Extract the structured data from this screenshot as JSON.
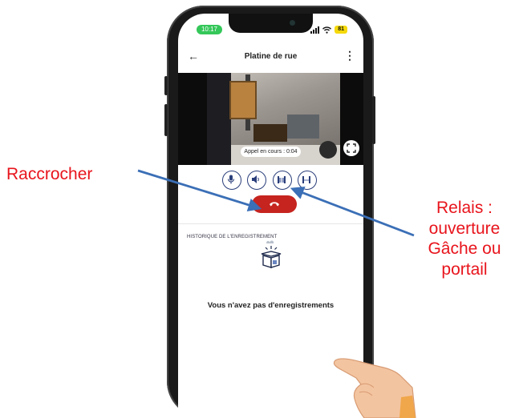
{
  "annotations": {
    "left": "Raccrocher",
    "right_lines": [
      "Relais :",
      "ouverture",
      "Gâche ou",
      "portail"
    ]
  },
  "status_bar": {
    "time": "10:17",
    "battery": "81"
  },
  "app_bar": {
    "title": "Platine de rue",
    "back_icon": "arrow-left-icon",
    "menu_icon": "kebab-menu-icon"
  },
  "video": {
    "call_status": "Appel en cours : 0:04"
  },
  "controls": [
    {
      "name": "microphone",
      "icon": "microphone-icon"
    },
    {
      "name": "speaker",
      "icon": "speaker-icon"
    },
    {
      "name": "relay-1",
      "icon": "gate-icon"
    },
    {
      "name": "relay-2",
      "icon": "gate-icon"
    }
  ],
  "history": {
    "title": "HISTORIQUE DE L'ENREGISTREMENT",
    "empty_message": "Vous n'avez pas d'enregistrements"
  },
  "colors": {
    "accent": "#2a3e7a",
    "hangup": "#c6241f",
    "annotation": "#e8141c",
    "arrow": "#3b6fb6"
  }
}
